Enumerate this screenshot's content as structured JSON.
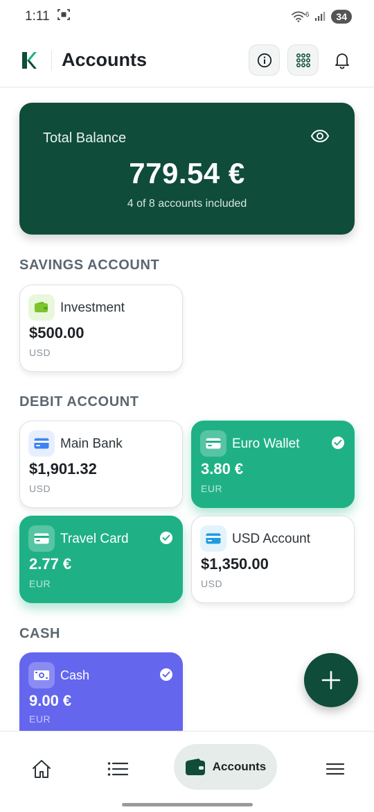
{
  "status": {
    "time": "1:11",
    "battery": "34",
    "wifi_sup": "6"
  },
  "header": {
    "title": "Accounts"
  },
  "balance": {
    "label": "Total Balance",
    "amount": "779.54 €",
    "subtitle": "4 of 8 accounts included"
  },
  "sections": {
    "savings": {
      "title": "SAVINGS ACCOUNT",
      "accounts": [
        {
          "name": "Investment",
          "amount": "$500.00",
          "currency": "USD",
          "selected": false
        }
      ]
    },
    "debit": {
      "title": "DEBIT ACCOUNT",
      "accounts": [
        {
          "name": "Main Bank",
          "amount": "$1,901.32",
          "currency": "USD",
          "selected": false
        },
        {
          "name": "Euro Wallet",
          "amount": "3.80 €",
          "currency": "EUR",
          "selected": true
        },
        {
          "name": "Travel Card",
          "amount": "2.77 €",
          "currency": "EUR",
          "selected": true
        },
        {
          "name": "USD Account",
          "amount": "$1,350.00",
          "currency": "USD",
          "selected": false
        }
      ]
    },
    "cash": {
      "title": "CASH",
      "accounts": [
        {
          "name": "Cash",
          "amount": "9.00 €",
          "currency": "EUR",
          "selected": true
        }
      ]
    }
  },
  "nav": {
    "active_label": "Accounts"
  },
  "colors": {
    "primary": "#0f4c3a",
    "selected_green": "#1fb185",
    "cash_purple": "#6466ee",
    "section_text": "#5b6670"
  }
}
